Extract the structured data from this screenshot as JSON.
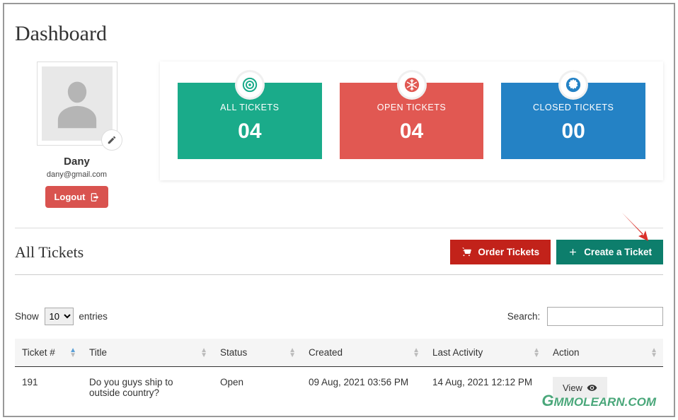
{
  "page_title": "Dashboard",
  "profile": {
    "name": "Dany",
    "email": "dany@gmail.com",
    "logout_label": "Logout"
  },
  "stats": {
    "all_label": "ALL TICKETS",
    "all_count": "04",
    "open_label": "OPEN TICKETS",
    "open_count": "04",
    "closed_label": "CLOSED TICKETS",
    "closed_count": "00"
  },
  "section": {
    "title": "All Tickets",
    "order_btn": "Order Tickets",
    "create_btn": "Create a Ticket"
  },
  "table_controls": {
    "show_prefix": "Show",
    "show_suffix": "entries",
    "entries_value": "10",
    "search_label": "Search:"
  },
  "columns": {
    "ticket_no": "Ticket #",
    "title": "Title",
    "status": "Status",
    "created": "Created",
    "last_activity": "Last Activity",
    "action": "Action"
  },
  "rows": [
    {
      "id": "191",
      "title": "Do you guys ship to outside country?",
      "status": "Open",
      "created": "09 Aug, 2021 03:56 PM",
      "last_activity": "14 Aug, 2021 12:12 PM",
      "action_label": "View"
    }
  ],
  "watermark": "MMOLEARN.COM"
}
